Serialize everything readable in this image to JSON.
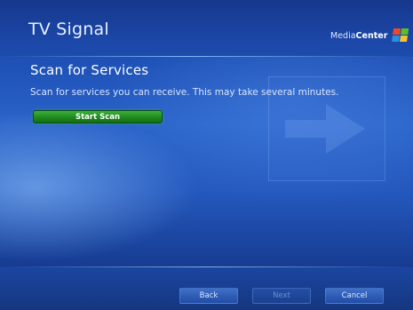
{
  "header": {
    "title": "TV Signal",
    "brand_prefix": "Media",
    "brand_bold": "Center",
    "logo_icon": "windows-flag-icon"
  },
  "main": {
    "heading": "Scan for Services",
    "description": "Scan for services you can receive. This may take several minutes.",
    "start_button": "Start Scan",
    "watermark_icon": "arrow-right-icon"
  },
  "footer": {
    "back": "Back",
    "next": "Next",
    "cancel": "Cancel"
  },
  "colors": {
    "accent_green": "#1e8a1f",
    "background_blue": "#2458bd"
  }
}
